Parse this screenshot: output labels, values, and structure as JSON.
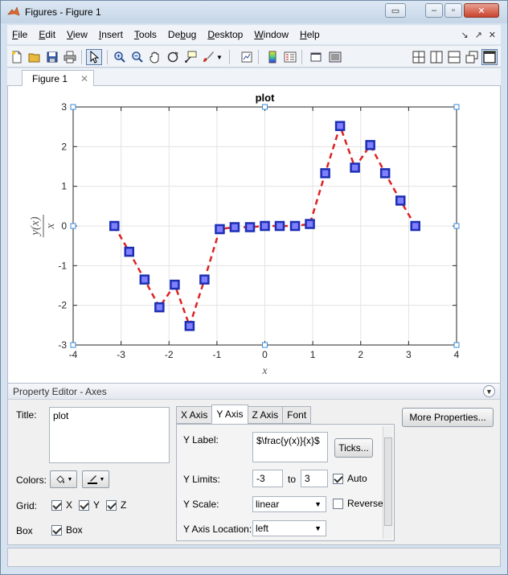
{
  "window": {
    "title": "Figures - Figure 1"
  },
  "menu": [
    {
      "label": "File",
      "key": "F",
      "rest": "ile"
    },
    {
      "label": "Edit",
      "key": "E",
      "rest": "dit"
    },
    {
      "label": "View",
      "key": "V",
      "rest": "iew"
    },
    {
      "label": "Insert",
      "key": "I",
      "rest": "nsert"
    },
    {
      "label": "Tools",
      "key": "T",
      "rest": "ools"
    },
    {
      "label": "Debug",
      "key": "b",
      "pre": "De",
      "rest": "ug"
    },
    {
      "label": "Desktop",
      "key": "D",
      "rest": "esktop"
    },
    {
      "label": "Window",
      "key": "W",
      "rest": "indow"
    },
    {
      "label": "Help",
      "key": "H",
      "rest": "elp"
    }
  ],
  "tab": {
    "label": "Figure 1"
  },
  "chart_data": {
    "type": "line",
    "title": "plot",
    "xlabel": "x",
    "ylabel": "y(x)/x",
    "xlim": [
      -4,
      4
    ],
    "ylim": [
      -3,
      3
    ],
    "xticks": [
      -4,
      -3,
      -2,
      -1,
      0,
      1,
      2,
      3,
      4
    ],
    "yticks": [
      -3,
      -2,
      -1,
      0,
      1,
      2,
      3
    ],
    "grid": true,
    "series": [
      {
        "line_style": "dashed",
        "line_color": "#dd2222",
        "marker": "square",
        "marker_face": "#7f7fff",
        "marker_edge": "#1c2fb3",
        "x": [
          -3.14,
          -2.83,
          -2.51,
          -2.2,
          -1.88,
          -1.57,
          -1.26,
          -0.94,
          -0.63,
          -0.31,
          0.0,
          0.31,
          0.63,
          0.94,
          1.26,
          1.57,
          1.88,
          2.2,
          2.51,
          2.83,
          3.14
        ],
        "y": [
          0.0,
          -0.65,
          -1.35,
          -2.05,
          -1.48,
          -2.52,
          -1.35,
          -0.08,
          -0.03,
          -0.03,
          0.0,
          0.0,
          0.0,
          0.05,
          1.33,
          2.52,
          1.47,
          2.04,
          1.33,
          0.64,
          0.0
        ]
      }
    ]
  },
  "property_editor": {
    "header": "Property Editor - Axes",
    "title_label": "Title:",
    "title_value": "plot",
    "colors_label": "Colors:",
    "grid_label": "Grid:",
    "grid_x": "X",
    "grid_y": "Y",
    "grid_z": "Z",
    "box_label": "Box",
    "box_check_label": "Box",
    "tabs": [
      "X Axis",
      "Y Axis",
      "Z Axis",
      "Font"
    ],
    "ylabel_label": "Y Label:",
    "ylabel_value": "$\\frac{y(x)}{x}$",
    "ticks_button": "Ticks...",
    "ylimits_label": "Y Limits:",
    "ylim_min": "-3",
    "to_label": "to",
    "ylim_max": "3",
    "auto_label": "Auto",
    "yscale_label": "Y Scale:",
    "yscale_value": "linear",
    "reverse_label": "Reverse",
    "yaxis_location_label": "Y Axis Location:",
    "yaxis_location_value": "left",
    "more_properties": "More Properties..."
  }
}
